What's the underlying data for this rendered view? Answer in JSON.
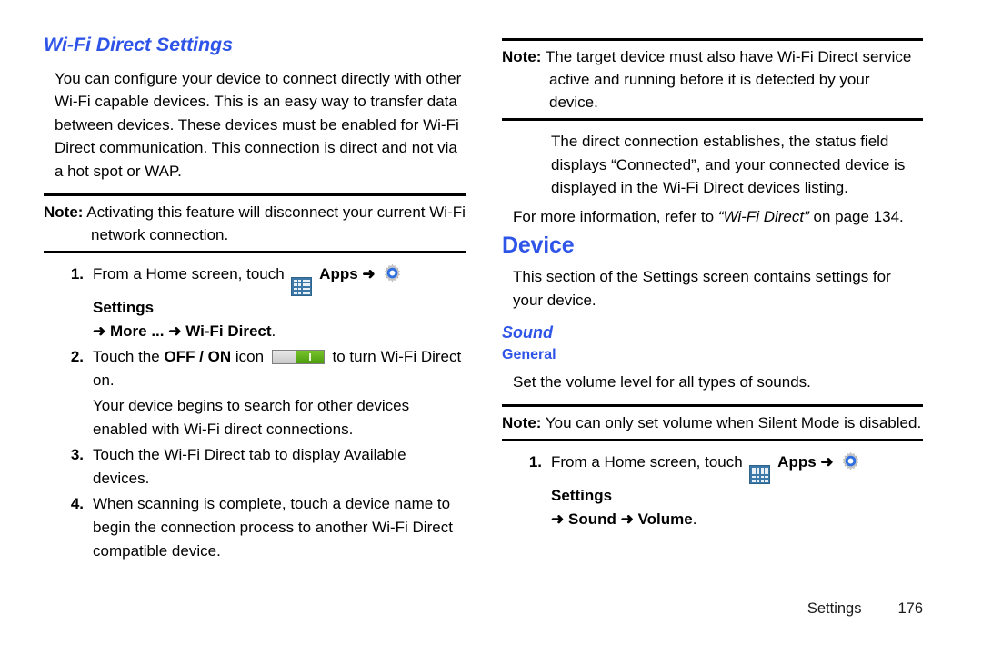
{
  "left_column": {
    "heading": "Wi-Fi Direct Settings",
    "intro_paragraph": "You can configure your device to connect directly with other Wi-Fi capable devices. This is an easy way to transfer data between devices. These devices must be enabled for Wi-Fi Direct communication. This connection is direct and not via a hot spot or WAP.",
    "note": {
      "label": "Note:",
      "text": "Activating this feature will disconnect your current Wi-Fi network connection."
    },
    "steps": [
      {
        "number": "1.",
        "text_before_apps": "From a Home screen, touch",
        "apps_label": "Apps",
        "arrow1": "➜",
        "settings_label": "Settings",
        "arrow2": "➜",
        "more_label": "More ...",
        "arrow3": "➜",
        "wifi_direct_label": "Wi-Fi Direct",
        "period": "."
      },
      {
        "number": "2.",
        "text_before": "Touch the",
        "toggle_label": "OFF / ON",
        "text_mid": "icon",
        "text_after": "to turn Wi-Fi Direct on.",
        "continuation": "Your device begins to search for other devices enabled with Wi-Fi direct connections."
      },
      {
        "number": "3.",
        "text": "Touch the Wi-Fi Direct tab to display Available devices."
      },
      {
        "number": "4.",
        "text": "When scanning is complete, touch a device name to begin the connection process to another Wi-Fi Direct compatible device."
      }
    ]
  },
  "right_column": {
    "note": {
      "label": "Note:",
      "text": "The target device must also have Wi-Fi Direct service active and running before it is detected by your device."
    },
    "indented_paragraph": "The direct connection establishes, the status field displays “Connected”, and your connected device is displayed in the Wi-Fi Direct devices listing.",
    "cross_reference": {
      "prefix": "For more information, refer to",
      "link_text": "“Wi-Fi Direct”",
      "suffix": "on page 134."
    },
    "device_heading": "Device",
    "device_paragraph": "This section of the Settings screen contains settings for your device.",
    "sound_heading": "Sound",
    "general_heading": "General",
    "general_paragraph": "Set the volume level for all types of sounds.",
    "note2": {
      "label": "Note:",
      "text": "You can only set volume when Silent Mode is disabled."
    },
    "steps": [
      {
        "number": "1.",
        "text_before_apps": "From a Home screen, touch",
        "apps_label": "Apps",
        "arrow1": "➜",
        "settings_label": "Settings",
        "arrow2": "➜",
        "sound_label": "Sound",
        "arrow3": "➜",
        "volume_label": "Volume",
        "period": "."
      }
    ]
  },
  "footer": {
    "section_label": "Settings",
    "page_number": "176"
  },
  "icons": {
    "apps": "apps-grid-icon",
    "settings": "settings-gear-icon",
    "toggle": "off-on-toggle-icon"
  },
  "colors": {
    "heading_blue": "#2f55e8",
    "rule_black": "#000000",
    "toggle_green": "#5aac18",
    "apps_blue": "#3d79a8"
  }
}
